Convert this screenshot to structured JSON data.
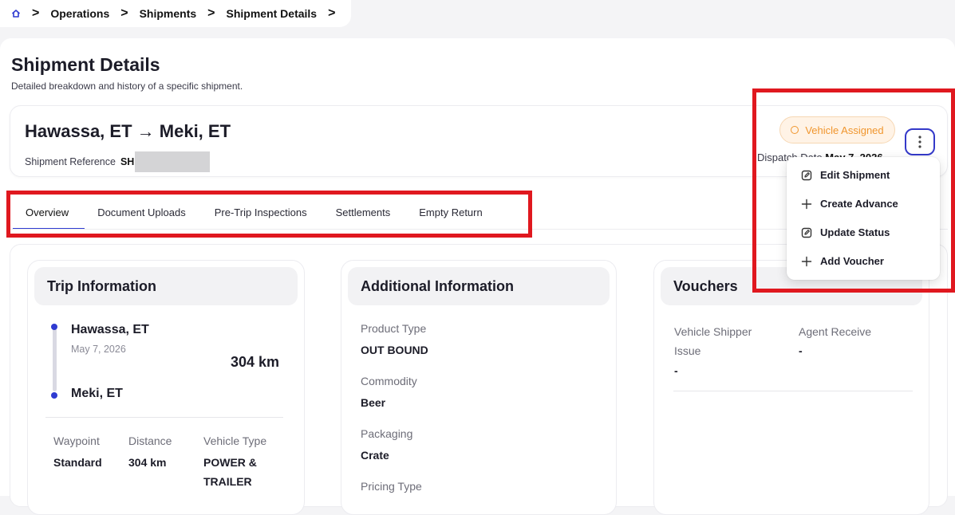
{
  "breadcrumb": {
    "items": [
      "Operations",
      "Shipments",
      "Shipment Details"
    ]
  },
  "page": {
    "title": "Shipment Details",
    "subtitle": "Detailed breakdown and history of a specific shipment."
  },
  "shipment": {
    "origin": "Hawassa, ET",
    "arrow": "→",
    "destination": "Meki, ET",
    "reference_label": "Shipment Reference",
    "reference_value": "SH",
    "status": "Vehicle Assigned",
    "dispatch_prefix": "Dispatch Date",
    "dispatch_value": "May 7, 2026"
  },
  "tabs": [
    "Overview",
    "Document Uploads",
    "Pre-Trip Inspections",
    "Settlements",
    "Empty Return"
  ],
  "trip": {
    "title": "Trip Information",
    "origin": "Hawassa, ET",
    "date": "May 7, 2026",
    "distance": "304 km",
    "destination": "Meki, ET",
    "waypoint_label": "Waypoint",
    "waypoint_value": "Standard",
    "distance_label": "Distance",
    "distance_value": "304 km",
    "vehicle_type_label": "Vehicle Type",
    "vehicle_type_value_1": "POWER &",
    "vehicle_type_value_2": "TRAILER"
  },
  "additional": {
    "title": "Additional Information",
    "product_type_label": "Product Type",
    "product_type_value": "OUT BOUND",
    "commodity_label": "Commodity",
    "commodity_value": "Beer",
    "packaging_label": "Packaging",
    "packaging_value": "Crate",
    "pricing_type_label": "Pricing Type"
  },
  "vouchers": {
    "title": "Vouchers",
    "vehicle_shipper_issue_label_1": "Vehicle Shipper",
    "vehicle_shipper_issue_label_2": "Issue",
    "vehicle_shipper_issue_value": "-",
    "agent_receive_label": "Agent Receive",
    "agent_receive_value": "-"
  },
  "menu": {
    "items": [
      {
        "label": "Edit Shipment",
        "icon": "edit-icon"
      },
      {
        "label": "Create Advance",
        "icon": "plus-icon"
      },
      {
        "label": "Update Status",
        "icon": "edit-icon"
      },
      {
        "label": "Add Voucher",
        "icon": "plus-icon"
      }
    ]
  },
  "colors": {
    "accent": "#2f3bd1",
    "status_text": "#f0962e",
    "status_bg": "#fff3e6",
    "highlight": "#e0181f"
  }
}
